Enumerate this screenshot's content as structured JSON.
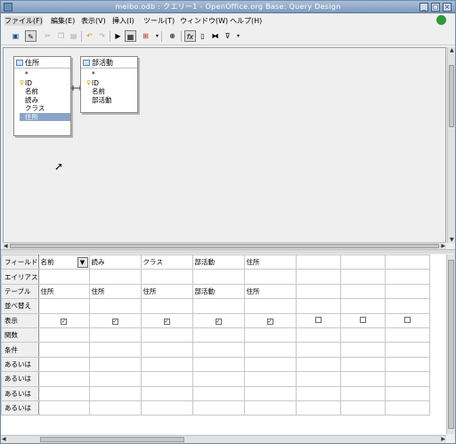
{
  "window": {
    "title": "meibo.odb : クエリー1 - OpenOffice.org Base: Query Design"
  },
  "menu": [
    "ファイル(F)",
    "編集(E)",
    "表示(V)",
    "挿入(I)",
    "ツール(T)",
    "ウィンドウ(W)",
    "ヘルプ(H)"
  ],
  "toolbar_icons": [
    "save-icon",
    "edit-icon",
    "cut-icon",
    "copy-icon",
    "paste-icon",
    "undo-icon",
    "redo-icon",
    "run-query-icon",
    "design-view-icon",
    "add-table-icon",
    "functions-icon",
    "table-name-icon",
    "alias-icon",
    "distinct-icon",
    "filter-icon"
  ],
  "tables": [
    {
      "name": "住所",
      "fields": [
        "*",
        "ID",
        "名前",
        "読み",
        "クラス",
        "住所"
      ],
      "key_index": 1,
      "selected_index": 5
    },
    {
      "name": "部活動",
      "fields": [
        "*",
        "ID",
        "名前",
        "部活動"
      ],
      "key_index": 1
    }
  ],
  "grid": {
    "row_labels": [
      "フィールド",
      "エイリアス",
      "テーブル",
      "並べ替え",
      "表示",
      "関数",
      "条件",
      "あるいは",
      "あるいは",
      "あるいは",
      "あるいは"
    ],
    "fields": [
      "名前",
      "読み",
      "クラス",
      "部活動",
      "住所",
      "",
      "",
      ""
    ],
    "tables": [
      "住所",
      "住所",
      "住所",
      "部活動",
      "住所",
      "",
      "",
      ""
    ],
    "visible": [
      true,
      true,
      true,
      true,
      true,
      false,
      false,
      false
    ]
  }
}
